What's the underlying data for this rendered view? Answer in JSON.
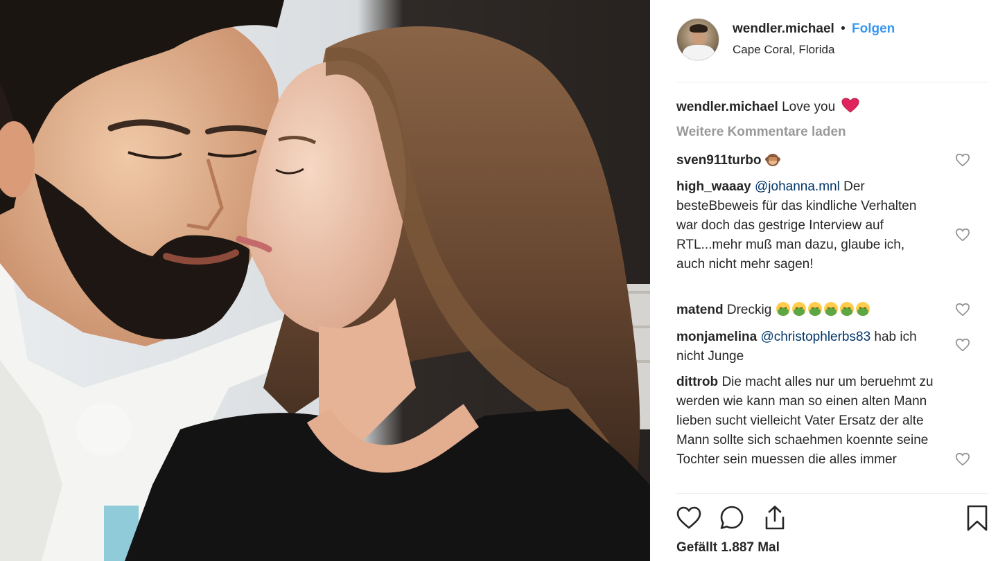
{
  "post": {
    "username": "wendler.michael",
    "separator": "•",
    "follow_label": "Folgen",
    "location": "Cape Coral, Florida",
    "caption_user": "wendler.michael",
    "caption_text": "Love you",
    "load_more": "Weitere Kommentare laden",
    "likes_text": "Gefällt 1.887 Mal"
  },
  "comments": [
    {
      "user": "sven911turbo",
      "pre": "",
      "mention": "",
      "text": "",
      "emoji": [
        "see-no-evil-monkey"
      ]
    },
    {
      "user": "high_waaay",
      "pre": "",
      "mention": "@johanna.mnl",
      "text": " Der besteBbeweis für das kindliche Verhalten war doch das gestrige Interview auf RTL...mehr muß man dazu, glaube ich, auch nicht mehr sagen!",
      "emoji": []
    },
    {
      "user": "matend",
      "pre": "",
      "mention": "",
      "text": "Dreckig ",
      "emoji": [
        "nauseated-face",
        "nauseated-face",
        "nauseated-face",
        "nauseated-face",
        "nauseated-face",
        "nauseated-face"
      ]
    },
    {
      "user": "monjamelina",
      "pre": "",
      "mention": "@christophlerbs83",
      "text": " hab ich nicht Junge",
      "emoji": []
    },
    {
      "user": "dittrob",
      "pre": "",
      "mention": "",
      "text": "Die macht alles nur um beruehmt zu werden wie kann man so einen alten Mann lieben sucht vielleicht Vater Ersatz der alte Mann sollte sich schaehmen koennte seine Tochter sein muessen die alles immer",
      "emoji": []
    }
  ],
  "icons": {
    "caption_emoji": "red-heart",
    "actions": [
      "heart-icon",
      "comment-icon",
      "share-icon",
      "bookmark-icon"
    ]
  },
  "colors": {
    "link": "#3897f0",
    "mention": "#003569",
    "muted": "#999999",
    "text": "#262626",
    "heart": "#e0245e"
  }
}
